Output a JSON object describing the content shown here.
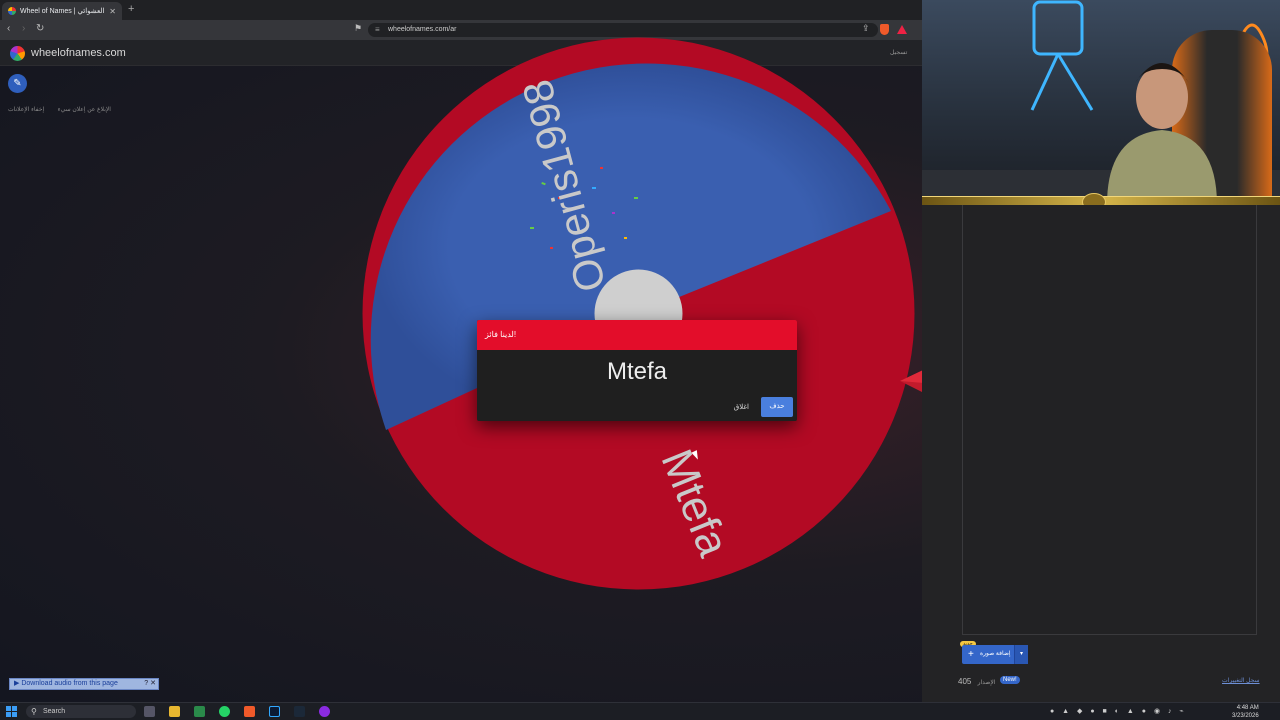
{
  "browser": {
    "tab_title": "Wheel of Names | العشوائي",
    "url": "wheelofnames.com/ar",
    "header_right_text": "تسجيل"
  },
  "site": {
    "name": "wheelofnames.com",
    "report_ad": "الإبلاغ عن إعلان سيء",
    "hide_ads": "إخفاء الإعلانات"
  },
  "wheel": {
    "entries": [
      "Operis1998",
      "Mtefa"
    ],
    "colors": {
      "blue": "#3a5fb0",
      "red": "#b30a24",
      "center": "#cfcfcf"
    }
  },
  "dialog": {
    "title": "لدينا فائز!",
    "winner": "Mtefa",
    "close_label": "اغلاق",
    "remove_label": "حذف",
    "header_color": "#e30d2a"
  },
  "extension": {
    "download_audio": "Download audio from this page",
    "extra": "? ✕"
  },
  "panel": {
    "new_tag": "جديد",
    "add_button": "إضافة صورة",
    "version_number": "405",
    "version_label": "الإصدار",
    "version_new": "New!",
    "changelog": "سجل التغييرات"
  },
  "taskbar": {
    "search_placeholder": "Search",
    "time": "4:48 AM",
    "date": "3/23/2026"
  }
}
